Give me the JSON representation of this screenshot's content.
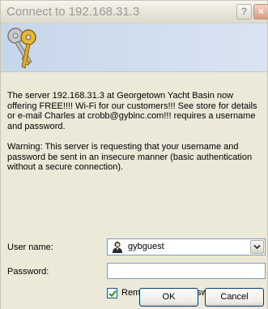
{
  "window": {
    "title": "Connect to 192.168.31.3",
    "help_glyph": "?",
    "close_glyph": "×"
  },
  "message": {
    "server_text": "The server 192.168.31.3 at Georgetown Yacht Basin now offering FREE!!!! Wi-Fi for our customers!!! See store for details or e-mail Charles at crobb@gybinc.com!!! requires a username and password.",
    "warning_text": "Warning: This server is requesting that your username and password be sent in an insecure manner (basic authentication without a secure connection)."
  },
  "form": {
    "username_label": "User name:",
    "username_value": "gybguest",
    "password_label": "Password:",
    "password_value": "",
    "remember_label": "Remember my password",
    "remember_checked": true
  },
  "buttons": {
    "ok_label": "OK",
    "cancel_label": "Cancel"
  },
  "icons": {
    "banner": "keys-icon",
    "user": "user-icon",
    "dropdown": "chevron-down-icon"
  },
  "colors": {
    "dialog_bg": "#ece9d8",
    "banner_bg": "#c9d9ea",
    "field_border": "#7f9db9",
    "button_border": "#003c74",
    "title_text": "#9a9a9a",
    "check_mark": "#21a121"
  }
}
